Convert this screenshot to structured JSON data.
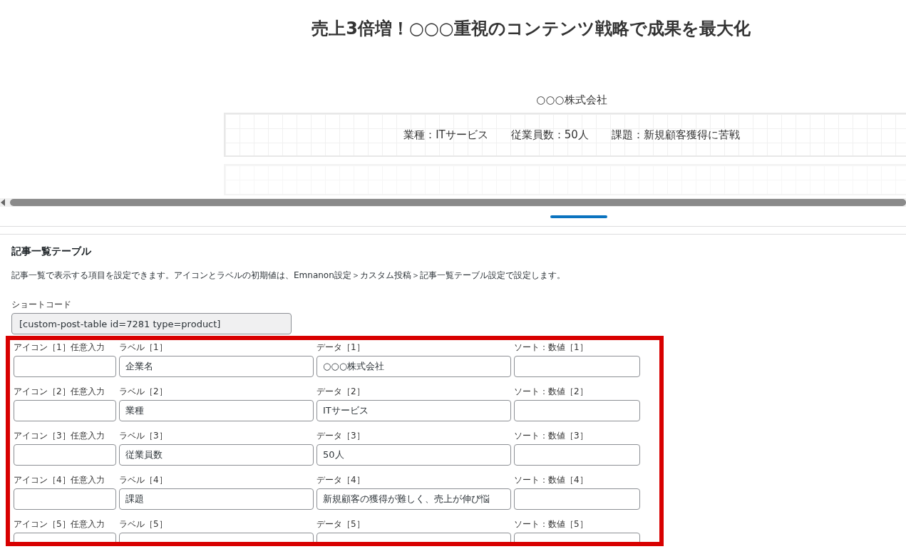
{
  "preview": {
    "title": "売上3倍増！○○○重視のコンテンツ戦略で成果を最大化",
    "company": "○○○株式会社",
    "summary": [
      "業種：ITサービス",
      "従業員数：50人",
      "課題：新規顧客獲得に苦戦"
    ]
  },
  "section": {
    "title": "記事一覧テーブル",
    "description": "記事一覧で表示する項目を設定できます。アイコンとラベルの初期値は、Emnanon設定＞カスタム投稿＞記事一覧テーブル設定で設定します。",
    "shortcode_label": "ショートコード",
    "shortcode": "[custom-post-table id=7281 type=product]"
  },
  "rows": [
    {
      "icon_label": "アイコン［1］任意入力",
      "label_label": "ラベル［1］",
      "label": "企業名",
      "data_label": "データ［1］",
      "data": "○○○株式会社",
      "sort_label": "ソート：数値［1］"
    },
    {
      "icon_label": "アイコン［2］任意入力",
      "label_label": "ラベル［2］",
      "label": "業種",
      "data_label": "データ［2］",
      "data": "ITサービス",
      "sort_label": "ソート：数値［2］"
    },
    {
      "icon_label": "アイコン［3］任意入力",
      "label_label": "ラベル［3］",
      "label": "従業員数",
      "data_label": "データ［3］",
      "data": "50人",
      "sort_label": "ソート：数値［3］"
    },
    {
      "icon_label": "アイコン［4］任意入力",
      "label_label": "ラベル［4］",
      "label": "課題",
      "data_label": "データ［4］",
      "data": "新規顧客の獲得が難しく、売上が伸び悩",
      "sort_label": "ソート：数値［4］"
    },
    {
      "icon_label": "アイコン［5］任意入力",
      "label_label": "ラベル［5］",
      "data_label": "データ［5］",
      "sort_label": "ソート：数値［5］"
    }
  ]
}
